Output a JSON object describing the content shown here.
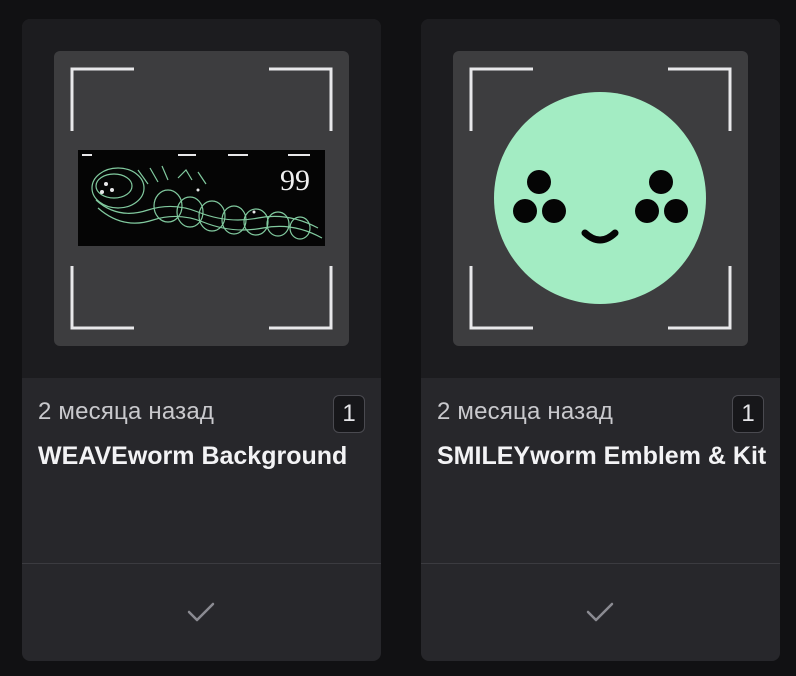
{
  "cards": [
    {
      "date": "2 месяца назад",
      "count": "1",
      "title": "WEAVEworm Background",
      "thumb_text": "99"
    },
    {
      "date": "2 месяца назад",
      "count": "1",
      "title": "SMILEYworm Emblem & Kit"
    }
  ],
  "colors": {
    "page_bg": "#111113",
    "card_bg": "#27272b",
    "thumb_bg": "#3d3d3f",
    "smiley_face": "#a3ecc3",
    "worm_line": "#8fe0b0"
  },
  "icons": {
    "select": "check-icon",
    "frame": "scan-frame-icon"
  }
}
